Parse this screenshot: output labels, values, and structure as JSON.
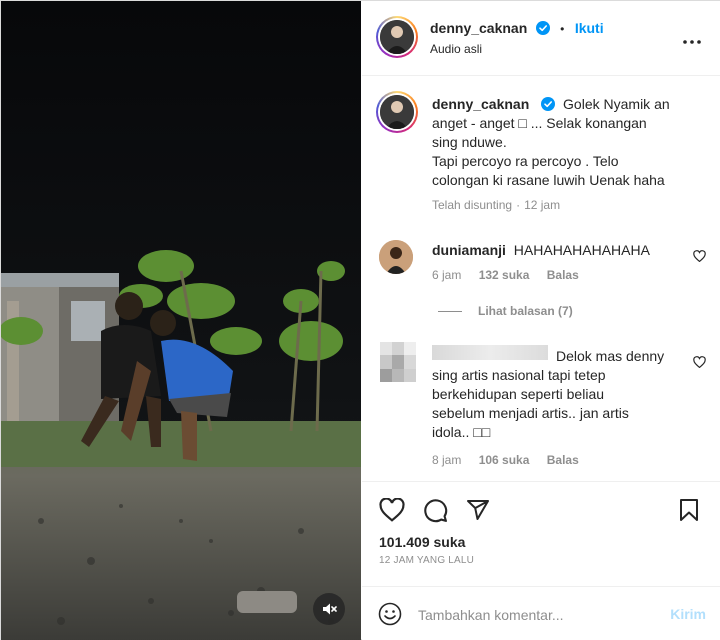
{
  "post": {
    "username": "denny_caknan",
    "verified": true,
    "separator": "•",
    "follow_label": "Ikuti",
    "audio_label": "Audio asli",
    "more_label": "•••"
  },
  "caption": {
    "username": "denny_caknan",
    "text_line1": "Golek Nyamik an",
    "text_line2": "anget - anget □ ... Selak konangan",
    "text_line3": "sing nduwe.",
    "text_line4": "Tapi percoyo ra percoyo . Telo",
    "text_line5": "colongan ki rasane luwih Uenak haha",
    "edited_label": "Telah disunting",
    "dot": "·",
    "time": "12 jam"
  },
  "comments": [
    {
      "username": "duniamanji",
      "text": "HAHAHAHAHAHAHA",
      "time": "6 jam",
      "likes": "132 suka",
      "reply_label": "Balas"
    },
    {
      "username": "",
      "text_line1": "Delok mas denny",
      "text_line2": "sing artis nasional tapi tetep",
      "text_line3": "berkehidupan seperti beliau",
      "text_line4": "sebelum menjadi artis.. jan artis",
      "text_line5": "idola.. □□",
      "time": "8 jam",
      "likes": "106 suka",
      "reply_label": "Balas"
    }
  ],
  "view_replies_label": "Lihat balasan (7)",
  "actions": {
    "likes_count": "101.409 suka",
    "time_ago": "12 JAM YANG LALU"
  },
  "composer": {
    "placeholder": "Tambahkan komentar...",
    "post_label": "Kirim"
  },
  "colors": {
    "accent": "#0095f6",
    "muted": "#8e8e8e",
    "text": "#262626",
    "post_disabled": "#b2dffc"
  }
}
